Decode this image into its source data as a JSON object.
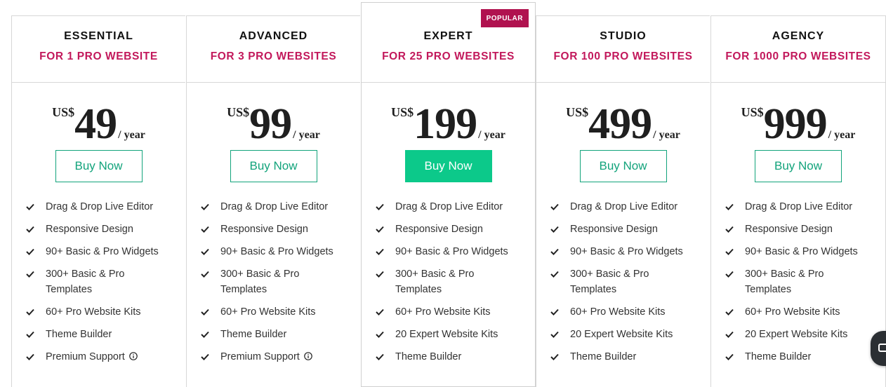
{
  "plans": [
    {
      "name": "ESSENTIAL",
      "subtitle": "FOR 1 PRO WEBSITE",
      "currency": "US$",
      "amount": "49",
      "period": "/ year",
      "button": "Buy Now",
      "features": [
        "Drag & Drop Live Editor",
        "Responsive Design",
        "90+ Basic & Pro Widgets",
        "300+ Basic & Pro Templates",
        "60+ Pro Website Kits",
        "Theme Builder",
        "Premium Support"
      ]
    },
    {
      "name": "ADVANCED",
      "subtitle": "FOR 3 PRO WEBSITES",
      "currency": "US$",
      "amount": "99",
      "period": "/ year",
      "button": "Buy Now",
      "features": [
        "Drag & Drop Live Editor",
        "Responsive Design",
        "90+ Basic & Pro Widgets",
        "300+ Basic & Pro Templates",
        "60+ Pro Website Kits",
        "Theme Builder",
        "Premium Support"
      ]
    },
    {
      "name": "EXPERT",
      "subtitle": "FOR 25 PRO WEBSITES",
      "badge": "POPULAR",
      "currency": "US$",
      "amount": "199",
      "period": "/ year",
      "button": "Buy Now",
      "features": [
        "Drag & Drop Live Editor",
        "Responsive Design",
        "90+ Basic & Pro Widgets",
        "300+ Basic & Pro Templates",
        "60+ Pro Website Kits",
        "20 Expert Website Kits",
        "Theme Builder"
      ]
    },
    {
      "name": "STUDIO",
      "subtitle": "FOR 100 PRO WEBSITES",
      "currency": "US$",
      "amount": "499",
      "period": "/ year",
      "button": "Buy Now",
      "features": [
        "Drag & Drop Live Editor",
        "Responsive Design",
        "90+ Basic & Pro Widgets",
        "300+ Basic & Pro Templates",
        "60+ Pro Website Kits",
        "20 Expert Website Kits",
        "Theme Builder"
      ]
    },
    {
      "name": "AGENCY",
      "subtitle": "FOR 1000 PRO WEBSITES",
      "currency": "US$",
      "amount": "999",
      "period": "/ year",
      "button": "Buy Now",
      "features": [
        "Drag & Drop Live Editor",
        "Responsive Design",
        "90+ Basic & Pro Widgets",
        "300+ Basic & Pro Templates",
        "60+ Pro Website Kits",
        "20 Expert Website Kits",
        "Theme Builder"
      ]
    }
  ],
  "colors": {
    "accent": "#c2185b",
    "badge": "#b0124f",
    "button_outline": "#12a37b",
    "button_solid": "#0cc98a"
  },
  "icons": {
    "feature": "check-icon",
    "support_info": "info-icon",
    "chat": "chat-icon"
  }
}
